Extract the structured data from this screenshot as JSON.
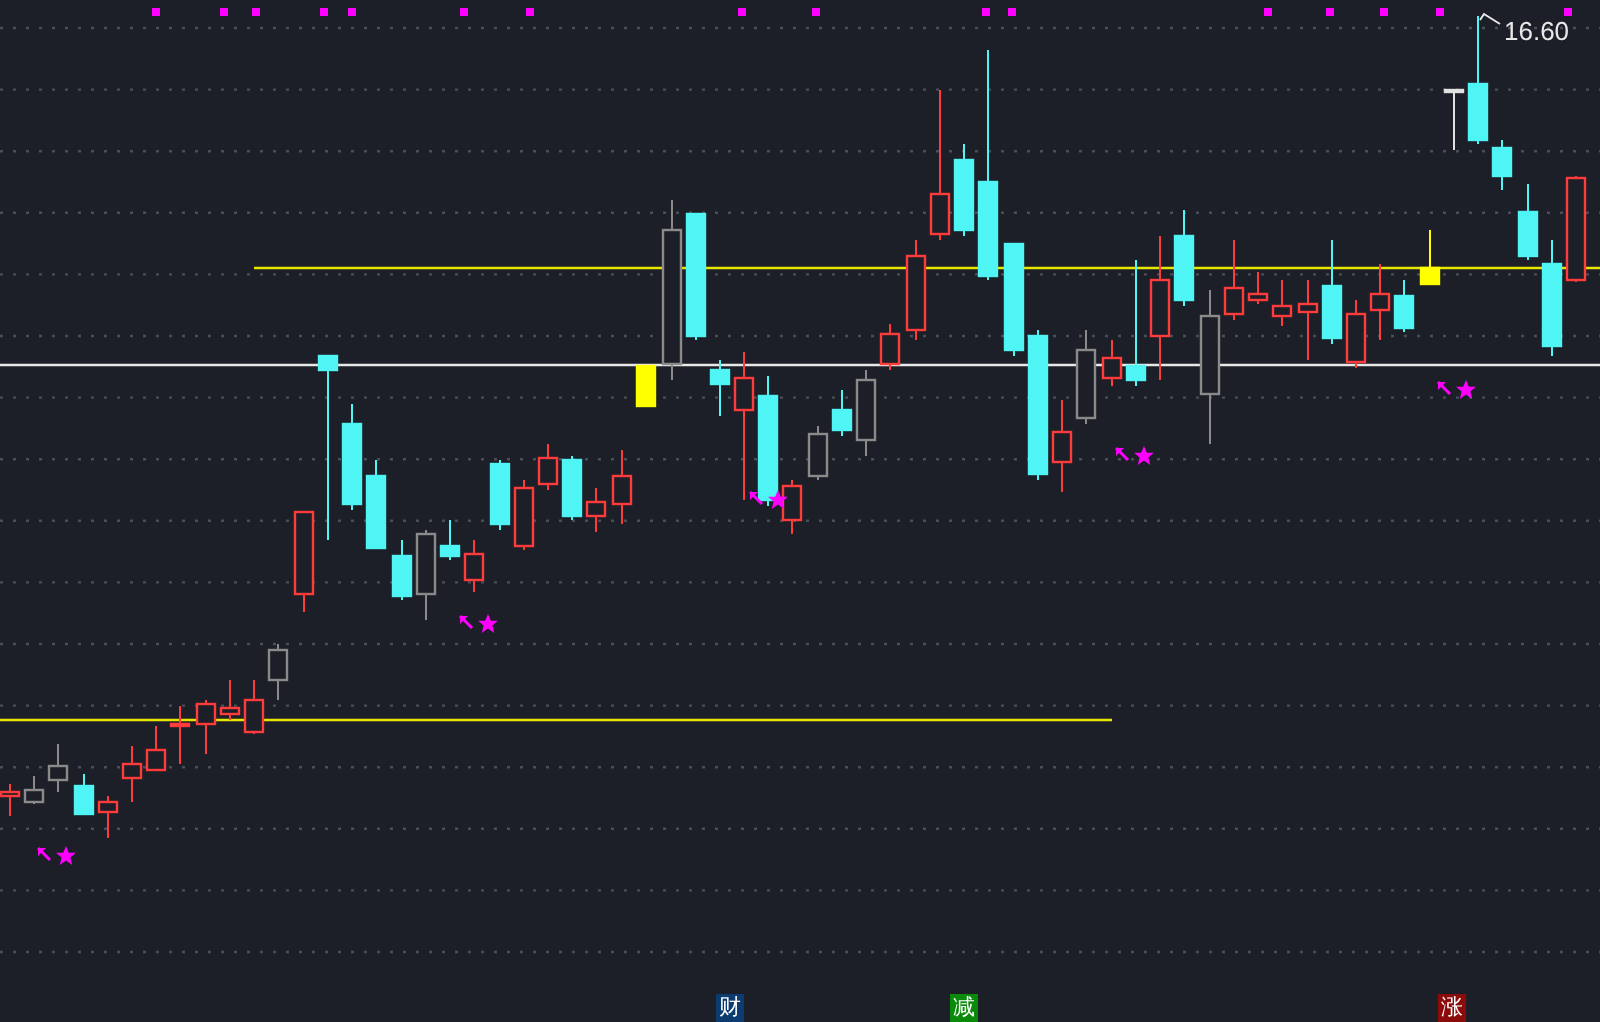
{
  "price_label": {
    "text": "16.60"
  },
  "event_badges": [
    {
      "text": "财",
      "color": "#0b3b6f"
    },
    {
      "text": "减",
      "color": "#0a8a0a"
    },
    {
      "text": "涨",
      "color": "#8b0a0a"
    }
  ]
}
